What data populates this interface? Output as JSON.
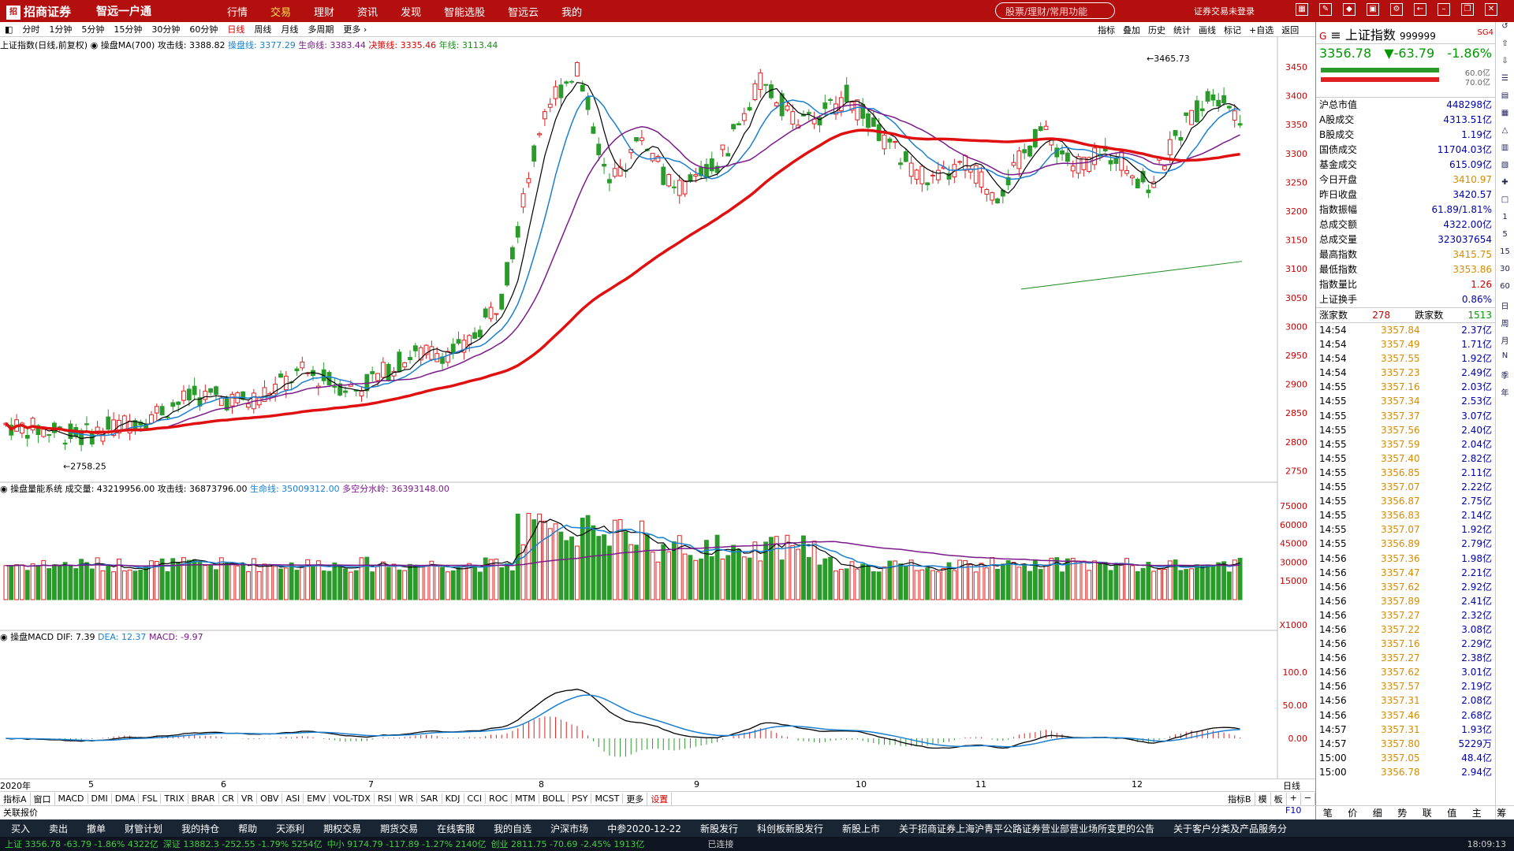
{
  "titlebar": {
    "logo_mark": "招",
    "logo": "招商证券",
    "app": "智远一户通",
    "nav": [
      "行情",
      "交易",
      "理财",
      "资讯",
      "发现",
      "智能选股",
      "智远云",
      "我的"
    ],
    "active_nav": 1,
    "search_placeholder": "股票/理财/常用功能",
    "login_status": "证券交易未登录"
  },
  "period": {
    "items": [
      "分时",
      "1分钟",
      "5分钟",
      "15分钟",
      "30分钟",
      "60分钟",
      "日线",
      "周线",
      "月线",
      "多周期",
      "更多 ›"
    ],
    "active": 6
  },
  "toolbar": [
    "指标",
    "叠加",
    "历史",
    "统计",
    "画线",
    "标记",
    "+自选",
    "返回"
  ],
  "ma_legend": {
    "title": "上证指数(日线,前复权)",
    "name": "操盘MA(700)",
    "attack": "攻击线: 3388.82",
    "operate": "操盘线: 3377.29",
    "life": "生命线: 3383.44",
    "decision": "决策线: 3335.46",
    "year": "年线: 3113.44"
  },
  "vol_legend": {
    "name": "操盘量能系统",
    "vol": "成交量: 43219956.00",
    "attack": "攻击线: 36873796.00",
    "life": "生命线: 35009312.00",
    "split": "多空分水岭: 36393148.00"
  },
  "macd_legend": {
    "name": "操盘MACD",
    "dif": "DIF: 7.39",
    "dea": "DEA: 12.37",
    "macd": "MACD: -9.97"
  },
  "price_axis": [
    "3450",
    "3400",
    "3350",
    "3300",
    "3250",
    "3200",
    "3150",
    "3100",
    "3050",
    "3000",
    "2950",
    "2900",
    "2850",
    "2800",
    "2750"
  ],
  "vol_axis": [
    "75000",
    "60000",
    "45000",
    "30000",
    "15000",
    "X1000"
  ],
  "macd_axis": [
    "100.0",
    "50.00",
    "0.00"
  ],
  "annotations": {
    "high": "3465.73",
    "low": "2758.25"
  },
  "dates": [
    "2020年",
    "5",
    "6",
    "7",
    "8",
    "9",
    "10",
    "11",
    "12",
    "日线"
  ],
  "indicators": [
    "指标A",
    "窗口",
    "MACD",
    "DMI",
    "DMA",
    "FSL",
    "TRIX",
    "BRAR",
    "CR",
    "VR",
    "OBV",
    "ASI",
    "EMV",
    "VOL-TDX",
    "RSI",
    "WR",
    "SAR",
    "KDJ",
    "CCI",
    "ROC",
    "MTM",
    "BOLL",
    "PSY",
    "MCST",
    "更多",
    "设置"
  ],
  "ind_right": [
    "指标B",
    "模",
    "板",
    "+",
    "−"
  ],
  "related": "关联报价",
  "quote": {
    "g": "G",
    "name": "上证指数",
    "code": "999999",
    "sg": "SG4",
    "price": "3356.78",
    "change": "▼-63.79",
    "pct": "-1.86%",
    "bar_top": "60.0亿",
    "bar_bot": "70.0亿",
    "rows": [
      [
        "沪总市值",
        "448298亿",
        "blue"
      ],
      [
        "A股成交",
        "4313.51亿",
        "blue"
      ],
      [
        "B股成交",
        "1.19亿",
        "blue"
      ],
      [
        "国债成交",
        "11704.03亿",
        "blue"
      ],
      [
        "基金成交",
        "615.09亿",
        "blue"
      ],
      [
        "今日开盘",
        "3410.97",
        "orange"
      ],
      [
        "昨日收盘",
        "3420.57",
        "blue"
      ],
      [
        "指数振幅",
        "61.89/1.81%",
        "blue"
      ],
      [
        "总成交额",
        "4322.00亿",
        "blue"
      ],
      [
        "总成交量",
        "323037654",
        "blue"
      ],
      [
        "最高指数",
        "3415.75",
        "orange"
      ],
      [
        "最低指数",
        "3353.86",
        "orange"
      ],
      [
        "指数量比",
        "1.26",
        "red"
      ],
      [
        "上证换手",
        "0.86%",
        "blue"
      ]
    ],
    "up_label": "涨家数",
    "up": "278",
    "down_label": "跌家数",
    "down": "1513"
  },
  "ticks": [
    [
      "14:54",
      "3357.84",
      "2.37亿"
    ],
    [
      "14:54",
      "3357.49",
      "1.71亿"
    ],
    [
      "14:54",
      "3357.55",
      "1.92亿"
    ],
    [
      "14:54",
      "3357.23",
      "2.49亿"
    ],
    [
      "14:55",
      "3357.16",
      "2.03亿"
    ],
    [
      "14:55",
      "3357.34",
      "2.53亿"
    ],
    [
      "14:55",
      "3357.37",
      "3.07亿"
    ],
    [
      "14:55",
      "3357.56",
      "2.40亿"
    ],
    [
      "14:55",
      "3357.59",
      "2.04亿"
    ],
    [
      "14:55",
      "3357.40",
      "2.82亿"
    ],
    [
      "14:55",
      "3356.85",
      "2.11亿"
    ],
    [
      "14:55",
      "3357.07",
      "2.22亿"
    ],
    [
      "14:55",
      "3356.87",
      "2.75亿"
    ],
    [
      "14:55",
      "3356.83",
      "2.14亿"
    ],
    [
      "14:55",
      "3357.07",
      "1.92亿"
    ],
    [
      "14:55",
      "3356.89",
      "2.79亿"
    ],
    [
      "14:56",
      "3357.36",
      "1.98亿"
    ],
    [
      "14:56",
      "3357.47",
      "2.21亿"
    ],
    [
      "14:56",
      "3357.62",
      "2.92亿"
    ],
    [
      "14:56",
      "3357.89",
      "2.41亿"
    ],
    [
      "14:56",
      "3357.27",
      "2.32亿"
    ],
    [
      "14:56",
      "3357.22",
      "3.08亿"
    ],
    [
      "14:56",
      "3357.16",
      "2.29亿"
    ],
    [
      "14:56",
      "3357.27",
      "2.38亿"
    ],
    [
      "14:56",
      "3357.62",
      "3.01亿"
    ],
    [
      "14:56",
      "3357.57",
      "2.19亿"
    ],
    [
      "14:56",
      "3357.31",
      "2.08亿"
    ],
    [
      "14:56",
      "3357.46",
      "2.68亿"
    ],
    [
      "14:57",
      "3357.31",
      "1.93亿"
    ],
    [
      "14:57",
      "3357.80",
      "5229万"
    ],
    [
      "15:00",
      "3357.05",
      "48.4亿"
    ],
    [
      "15:00",
      "3356.78",
      "2.94亿"
    ]
  ],
  "right_tabs": [
    "笔",
    "价",
    "细",
    "势",
    "联",
    "值",
    "主",
    "筹"
  ],
  "f10": "F10",
  "bottom": [
    "买入",
    "卖出",
    "撤单",
    "财管计划",
    "我的持仓",
    "帮助",
    "天添利",
    "期权交易",
    "期货交易",
    "在线客服",
    "我的自选",
    "沪深市场",
    "中参2020-12-22",
    "新股发行",
    "科创板新股发行",
    "新股上市",
    "关于招商证券上海沪青平公路证券营业部营业场所变更的公告",
    "关于客户分类及产品服务分"
  ],
  "status": {
    "sh": "上证 3356.78 -63.79 -1.86% 4322亿",
    "sz": "深证 13882.3 -252.55 -1.79% 5254亿",
    "zx": "中小 9174.79 -117.89 -1.27% 2140亿",
    "cy": "创业 2811.75 -70.69 -2.45% 1913亿",
    "conn": "已连接",
    "time": "18:09:13"
  },
  "sidetools": [
    "1",
    "5",
    "15",
    "30",
    "60",
    "日",
    "周",
    "月",
    "N",
    "季",
    "年"
  ]
}
